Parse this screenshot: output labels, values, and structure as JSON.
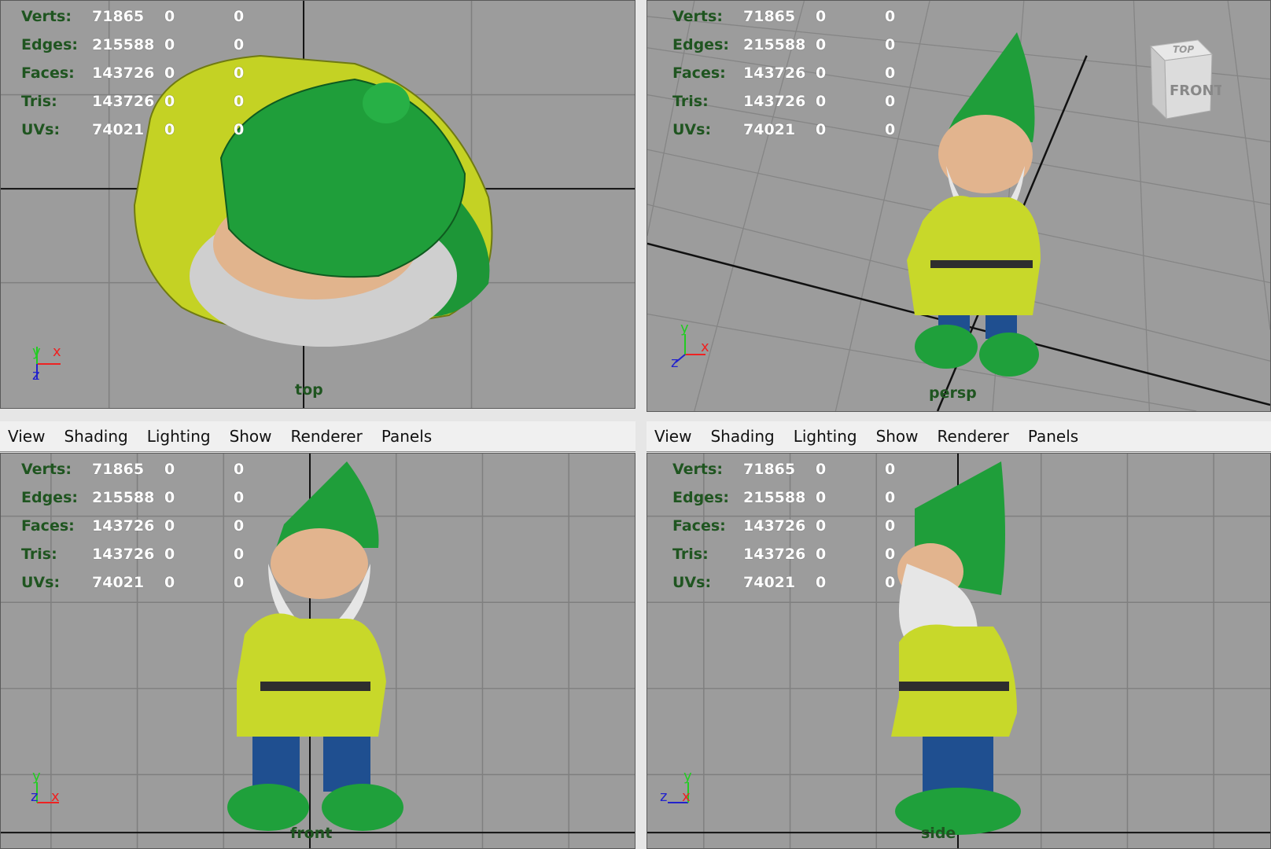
{
  "stats_labels": [
    "Verts:",
    "Edges:",
    "Faces:",
    "Tris:",
    "UVs:"
  ],
  "stats_values": [
    {
      "v1": "71865",
      "v2": "0",
      "v3": "0"
    },
    {
      "v1": "215588",
      "v2": "0",
      "v3": "0"
    },
    {
      "v1": "143726",
      "v2": "0",
      "v3": "0"
    },
    {
      "v1": "143726",
      "v2": "0",
      "v3": "0"
    },
    {
      "v1": "74021",
      "v2": "0",
      "v3": "0"
    }
  ],
  "menu": [
    "View",
    "Shading",
    "Lighting",
    "Show",
    "Renderer",
    "Panels"
  ],
  "panels": {
    "top": {
      "camera": "top"
    },
    "persp": {
      "camera": "persp"
    },
    "front": {
      "camera": "front"
    },
    "side": {
      "camera": "side"
    }
  },
  "viewcube": {
    "top": "TOP",
    "front": "FRONT"
  },
  "axis_letters": {
    "x": "x",
    "y": "y",
    "z": "z"
  },
  "colors": {
    "viewport_bg": "#9c9c9c",
    "grid_line": "#7f7f7f",
    "hud_label": "#1f5520",
    "hat_green": "#1f9e3a",
    "coat_yellow": "#c8d82a",
    "pants_blue": "#1f4f90",
    "skin": "#e2b48e",
    "beard": "#e0e0e0"
  }
}
